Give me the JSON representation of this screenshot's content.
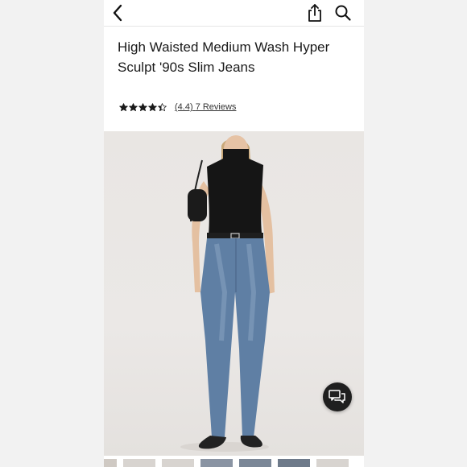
{
  "header": {
    "back_icon": "chevron-left-icon",
    "share_icon": "share-icon",
    "search_icon": "search-icon"
  },
  "product": {
    "title": "High Waisted Medium Wash Hyper Sculpt '90s Slim Jeans",
    "rating": 4.4,
    "rating_text": "(4.4)",
    "reviews_text": "7 Reviews",
    "stars_max": 5
  },
  "chat": {
    "icon": "chat-bubbles-icon"
  },
  "colors": {
    "page_bg": "#f3f3f3",
    "text": "#1a1a1a",
    "chat_bg": "#1f1f1f"
  },
  "thumbnails": [
    {},
    {},
    {},
    {},
    {},
    {},
    {}
  ]
}
